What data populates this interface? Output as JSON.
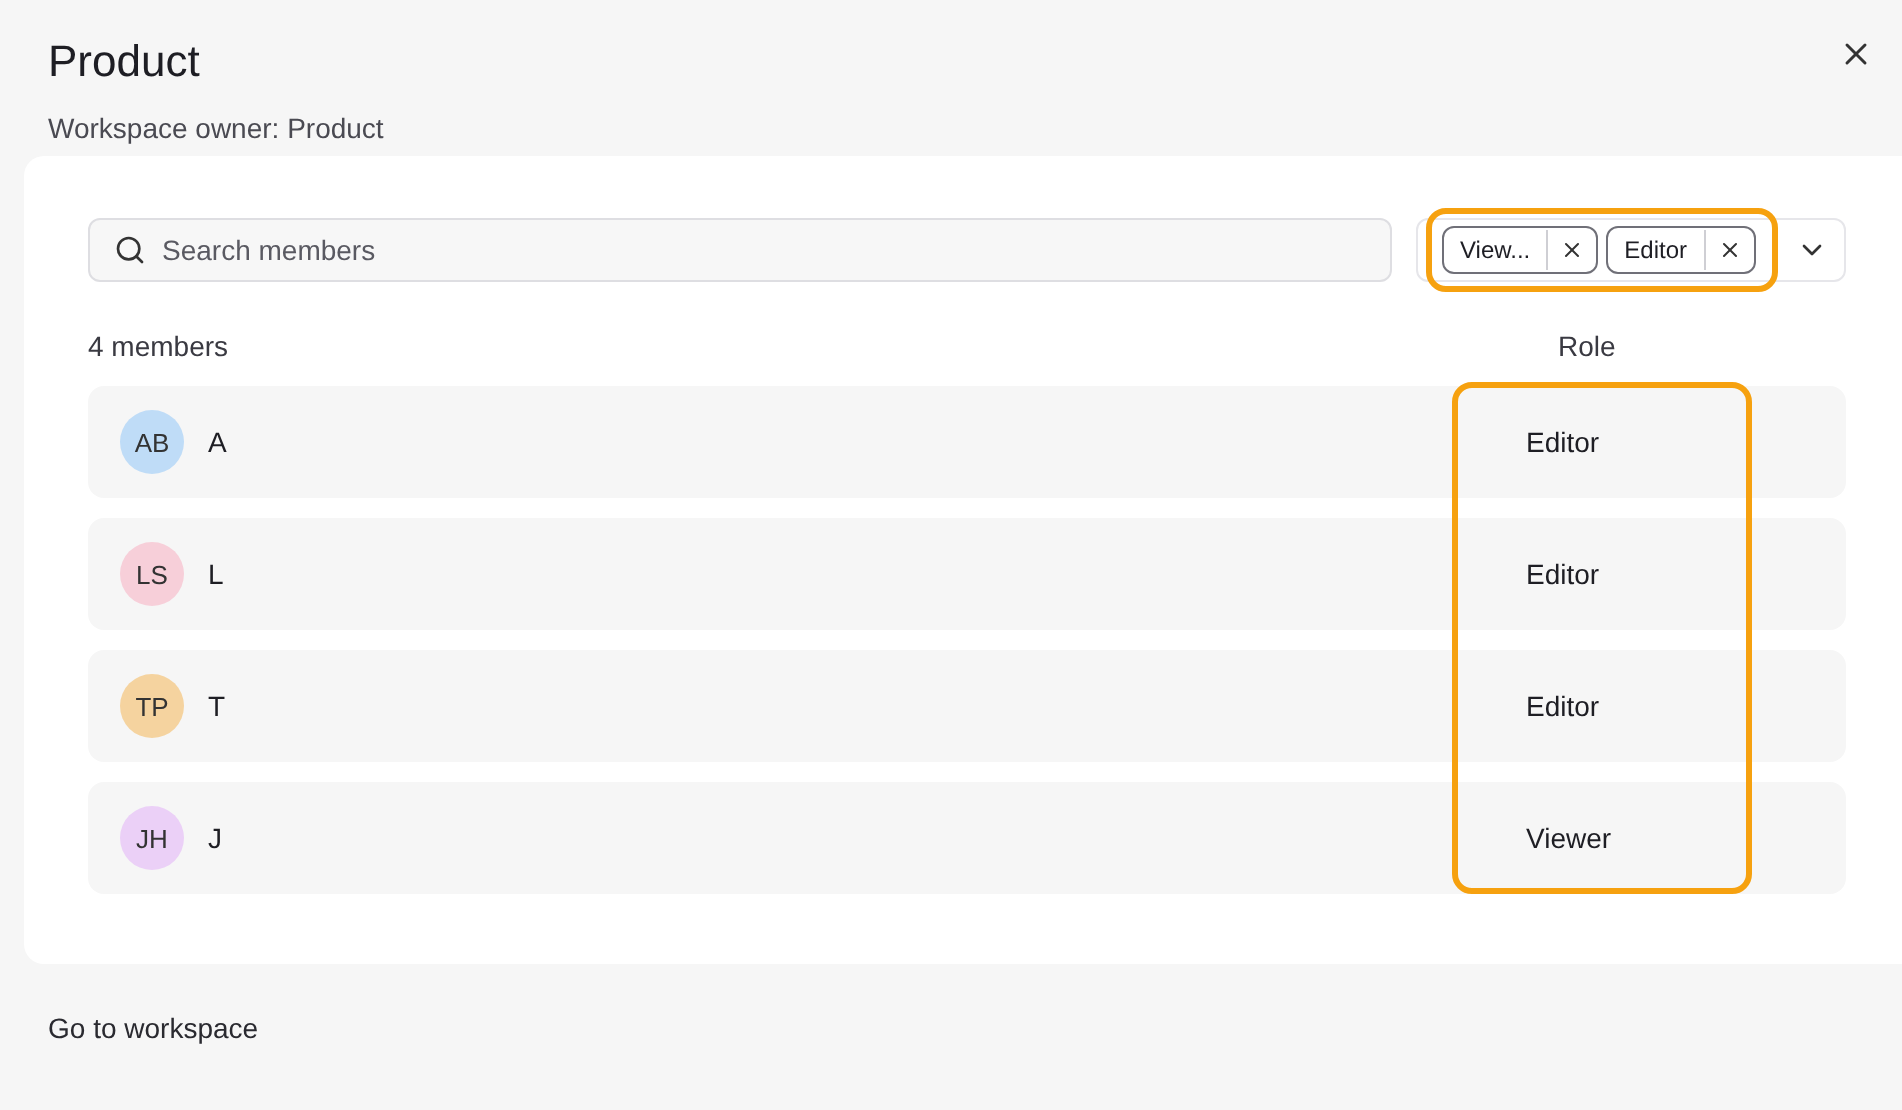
{
  "header": {
    "title": "Product",
    "subtitle": "Workspace owner: Product"
  },
  "search": {
    "placeholder": "Search members"
  },
  "filters": [
    {
      "label": "View..."
    },
    {
      "label": "Editor"
    }
  ],
  "member_count": "4 members",
  "role_heading": "Role",
  "members": [
    {
      "initials": "AB",
      "name": "A",
      "color": "#bfdcf7",
      "role": "Editor"
    },
    {
      "initials": "LS",
      "name": "L",
      "color": "#f7cfd9",
      "role": "Editor"
    },
    {
      "initials": "TP",
      "name": "T",
      "color": "#f5d39f",
      "role": "Editor"
    },
    {
      "initials": "JH",
      "name": "J",
      "color": "#ebd0f7",
      "role": "Viewer"
    }
  ],
  "footer_link": "Go to workspace"
}
